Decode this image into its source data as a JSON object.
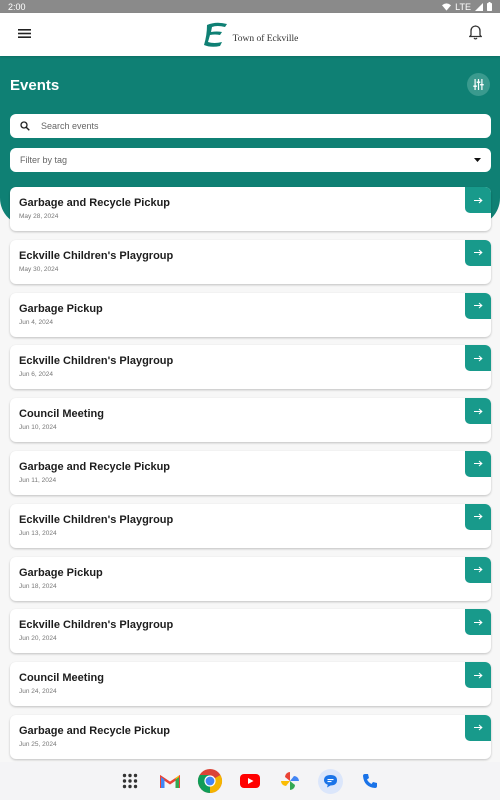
{
  "status_bar": {
    "time": "2:00",
    "network": "LTE"
  },
  "app_bar": {
    "logo_letter": "E",
    "logo_text": "Town of Eckville",
    "menu_icon": "hamburger-menu-icon",
    "notification_icon": "bell-icon"
  },
  "header": {
    "title": "Events",
    "filter_icon": "sliders-icon"
  },
  "search": {
    "placeholder": "Search events",
    "value": ""
  },
  "tag_filter": {
    "placeholder": "Filter by tag"
  },
  "events": [
    {
      "title": "Garbage and Recycle Pickup",
      "date": "May 28, 2024"
    },
    {
      "title": "Eckville Children's Playgroup",
      "date": "May 30, 2024"
    },
    {
      "title": "Garbage Pickup",
      "date": "Jun 4, 2024"
    },
    {
      "title": "Eckville Children's Playgroup",
      "date": "Jun 6, 2024"
    },
    {
      "title": "Council Meeting",
      "date": "Jun 10, 2024"
    },
    {
      "title": "Garbage and Recycle Pickup",
      "date": "Jun 11, 2024"
    },
    {
      "title": "Eckville Children's Playgroup",
      "date": "Jun 13, 2024"
    },
    {
      "title": "Garbage Pickup",
      "date": "Jun 18, 2024"
    },
    {
      "title": "Eckville Children's Playgroup",
      "date": "Jun 20, 2024"
    },
    {
      "title": "Council Meeting",
      "date": "Jun 24, 2024"
    },
    {
      "title": "Garbage and Recycle Pickup",
      "date": "Jun 25, 2024"
    }
  ],
  "dock": [
    "apps-grid-icon",
    "gmail-icon",
    "chrome-icon",
    "youtube-icon",
    "photos-icon",
    "messages-icon",
    "phone-icon"
  ],
  "colors": {
    "brand_teal": "#0f8074",
    "button_teal": "#189a8b"
  }
}
